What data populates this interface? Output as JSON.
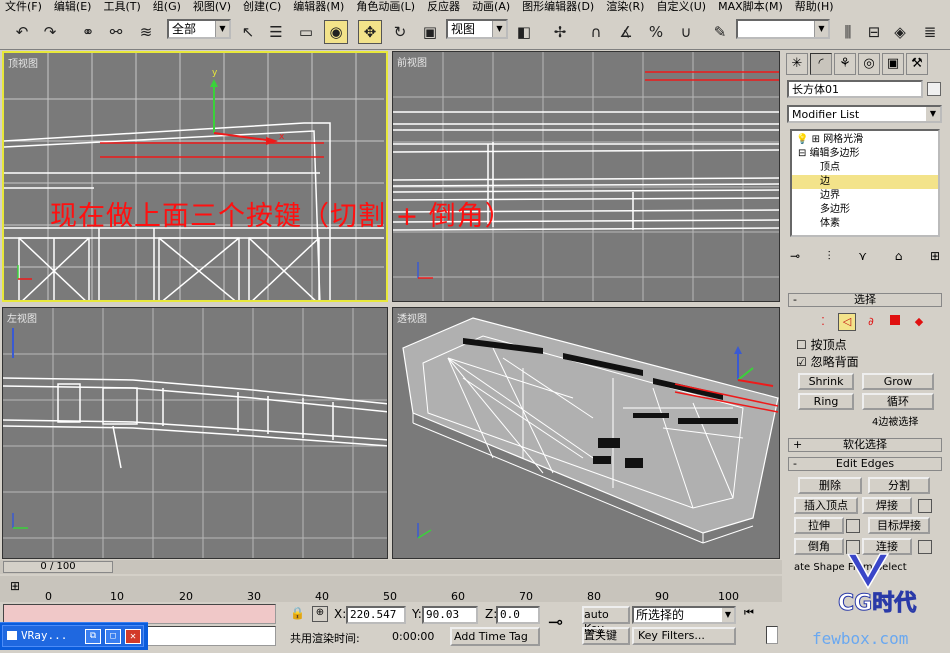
{
  "menu": [
    "文件(F)",
    "编辑(E)",
    "工具(T)",
    "组(G)",
    "视图(V)",
    "创建(C)",
    "编辑器(M)",
    "角色动画(L)",
    "反应器",
    "动画(A)",
    "图形编辑器(D)",
    "渲染(R)",
    "自定义(U)",
    "MAX脚本(M)",
    "帮助(H)"
  ],
  "toolbar": {
    "filter_value": "全部",
    "coord_value": "视图",
    "named_sel": ""
  },
  "viewports": {
    "top": "顶视图",
    "front": "前视图",
    "left": "左视图",
    "persp": "透视图"
  },
  "overlay_text": "现在做上面三个按键（切割 + 倒角）",
  "panel": {
    "object_name": "长方体01",
    "modifier_list": "Modifier List",
    "stack": [
      "网格光滑",
      "编辑多边形",
      "顶点",
      "边",
      "边界",
      "多边形",
      "体素"
    ],
    "selected_stack_item": "边",
    "select_rollout": "选择",
    "chk_by_vertex": "按顶点",
    "chk_ignore_back": "忽略背面",
    "btn_shrink": "Shrink",
    "btn_grow": "Grow",
    "btn_ring": "Ring",
    "btn_loop": "循环",
    "sel_status": "4边被选择",
    "soft_sel": "软化选择",
    "edit_edges": "Edit Edges",
    "btn_remove": "删除",
    "btn_split": "分割",
    "btn_insert_vertex": "插入顶点",
    "btn_weld": "焊接",
    "btn_extrude": "拉伸",
    "btn_target_weld": "目标焊接",
    "btn_chamfer": "倒角",
    "btn_connect": "连接",
    "shape_from": "ate Shape From Select"
  },
  "timeline": {
    "slider": "0 / 100",
    "ticks": [
      "0",
      "10",
      "20",
      "30",
      "40",
      "50",
      "60",
      "70",
      "80",
      "90",
      "100"
    ]
  },
  "status": {
    "x": "220.547",
    "y": "90.03",
    "z": "0.0",
    "x_label": "X:",
    "y_label": "Y:",
    "z_label": "Z:",
    "render_time_label": "共用渲染时间:",
    "render_time": "0:00:00",
    "add_time_tag": "Add Time Tag",
    "auto_key": "auto Key",
    "set_key": "置关键",
    "selected_dropdown": "所选择的",
    "key_filters": "Key Filters..."
  },
  "taskbar": {
    "item": "VRay..."
  },
  "watermark": {
    "text": "CG时代",
    "url": "fewbox.com"
  },
  "colors": {
    "viewport_bg": "#7a7a7a",
    "active_border": "#e8e83a",
    "selection_yellow": "#f3e38a",
    "overlay_red": "#ff1010"
  }
}
